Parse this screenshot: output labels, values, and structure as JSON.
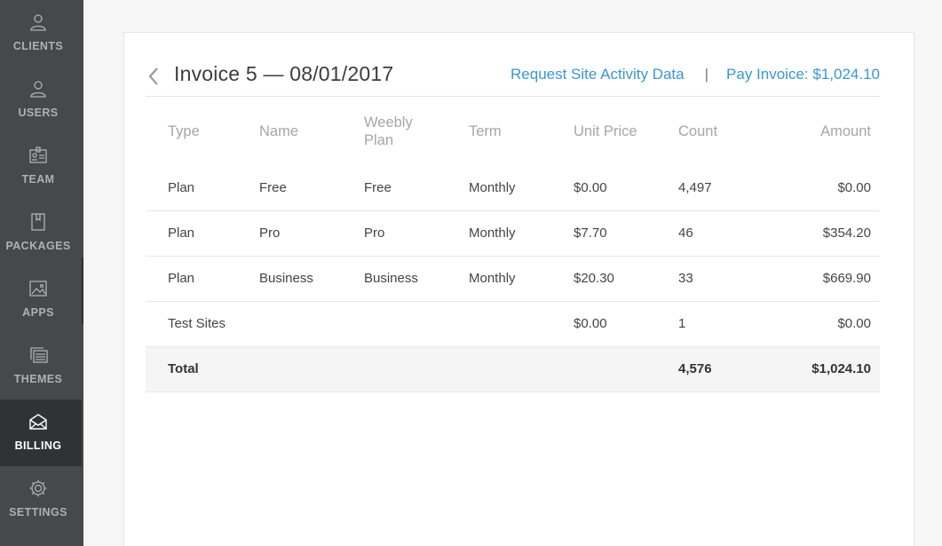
{
  "sidebar": {
    "items": [
      {
        "label": "CLIENTS",
        "icon": "user-icon"
      },
      {
        "label": "USERS",
        "icon": "user-icon"
      },
      {
        "label": "TEAM",
        "icon": "team-icon"
      },
      {
        "label": "PACKAGES",
        "icon": "package-icon"
      },
      {
        "label": "APPS",
        "icon": "image-icon"
      },
      {
        "label": "THEMES",
        "icon": "themes-icon"
      },
      {
        "label": "BILLING",
        "icon": "billing-icon",
        "active": true
      },
      {
        "label": "SETTINGS",
        "icon": "gear-icon"
      }
    ]
  },
  "invoice": {
    "title": "Invoice 5 — 08/01/2017",
    "request_link": "Request Site Activity Data",
    "separator": "|",
    "pay_link": "Pay Invoice: $1,024.10"
  },
  "table": {
    "headers": {
      "type": "Type",
      "name": "Name",
      "plan": "Weebly Plan",
      "term": "Term",
      "unit_price": "Unit Price",
      "count": "Count",
      "amount": "Amount"
    },
    "rows": [
      {
        "type": "Plan",
        "name": "Free",
        "plan": "Free",
        "term": "Monthly",
        "unit_price": "$0.00",
        "count": "4,497",
        "amount": "$0.00"
      },
      {
        "type": "Plan",
        "name": "Pro",
        "plan": "Pro",
        "term": "Monthly",
        "unit_price": "$7.70",
        "count": "46",
        "amount": "$354.20"
      },
      {
        "type": "Plan",
        "name": "Business",
        "plan": "Business",
        "term": "Monthly",
        "unit_price": "$20.30",
        "count": "33",
        "amount": "$669.90"
      },
      {
        "type": "Test Sites",
        "name": "",
        "plan": "",
        "term": "",
        "unit_price": "$0.00",
        "count": "1",
        "amount": "$0.00"
      }
    ],
    "total": {
      "label": "Total",
      "count": "4,576",
      "amount": "$1,024.10"
    }
  },
  "colors": {
    "sidebar_bg": "#46494c",
    "sidebar_active_bg": "#303234",
    "link": "#3b96cf"
  }
}
